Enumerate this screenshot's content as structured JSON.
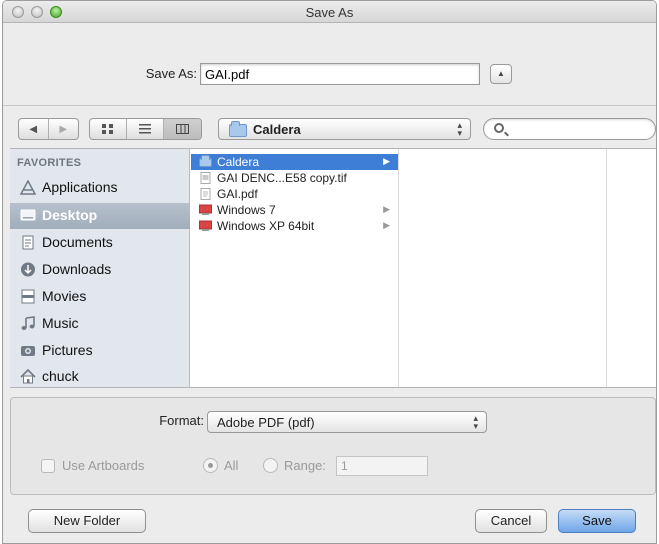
{
  "window": {
    "title": "Save As"
  },
  "save_as": {
    "label": "Save As:",
    "filename": "GAI.pdf"
  },
  "toolbar": {
    "view_icons": [
      "icon-view-icon",
      "list-view-icon",
      "column-view-icon"
    ],
    "location": "Caldera",
    "search_placeholder": ""
  },
  "sidebar": {
    "section": "FAVORITES",
    "items": [
      {
        "label": "Applications",
        "icon": "applications-icon"
      },
      {
        "label": "Desktop",
        "icon": "desktop-icon",
        "selected": true
      },
      {
        "label": "Documents",
        "icon": "documents-icon"
      },
      {
        "label": "Downloads",
        "icon": "downloads-icon"
      },
      {
        "label": "Movies",
        "icon": "movies-icon"
      },
      {
        "label": "Music",
        "icon": "music-icon"
      },
      {
        "label": "Pictures",
        "icon": "pictures-icon"
      },
      {
        "label": "chuck",
        "icon": "home-icon"
      }
    ]
  },
  "columns": {
    "first": [
      {
        "name": "Caldera",
        "kind": "folder",
        "selected": true
      },
      {
        "name": "GAI DENC...E58 copy.tif",
        "kind": "image"
      },
      {
        "name": "GAI.pdf",
        "kind": "pdf"
      },
      {
        "name": "Windows 7",
        "kind": "vm"
      },
      {
        "name": "Windows XP 64bit",
        "kind": "vm"
      }
    ]
  },
  "options": {
    "format_label": "Format:",
    "format_value": "Adobe PDF (pdf)",
    "use_artboards": "Use Artboards",
    "all": "All",
    "range": "Range:",
    "range_value": "1"
  },
  "buttons": {
    "new_folder": "New Folder",
    "cancel": "Cancel",
    "save": "Save"
  },
  "colors": {
    "selection": "#3f7ed6",
    "sidebar_bg": "#e2e7ed",
    "default_button": "#6fa6e8"
  }
}
